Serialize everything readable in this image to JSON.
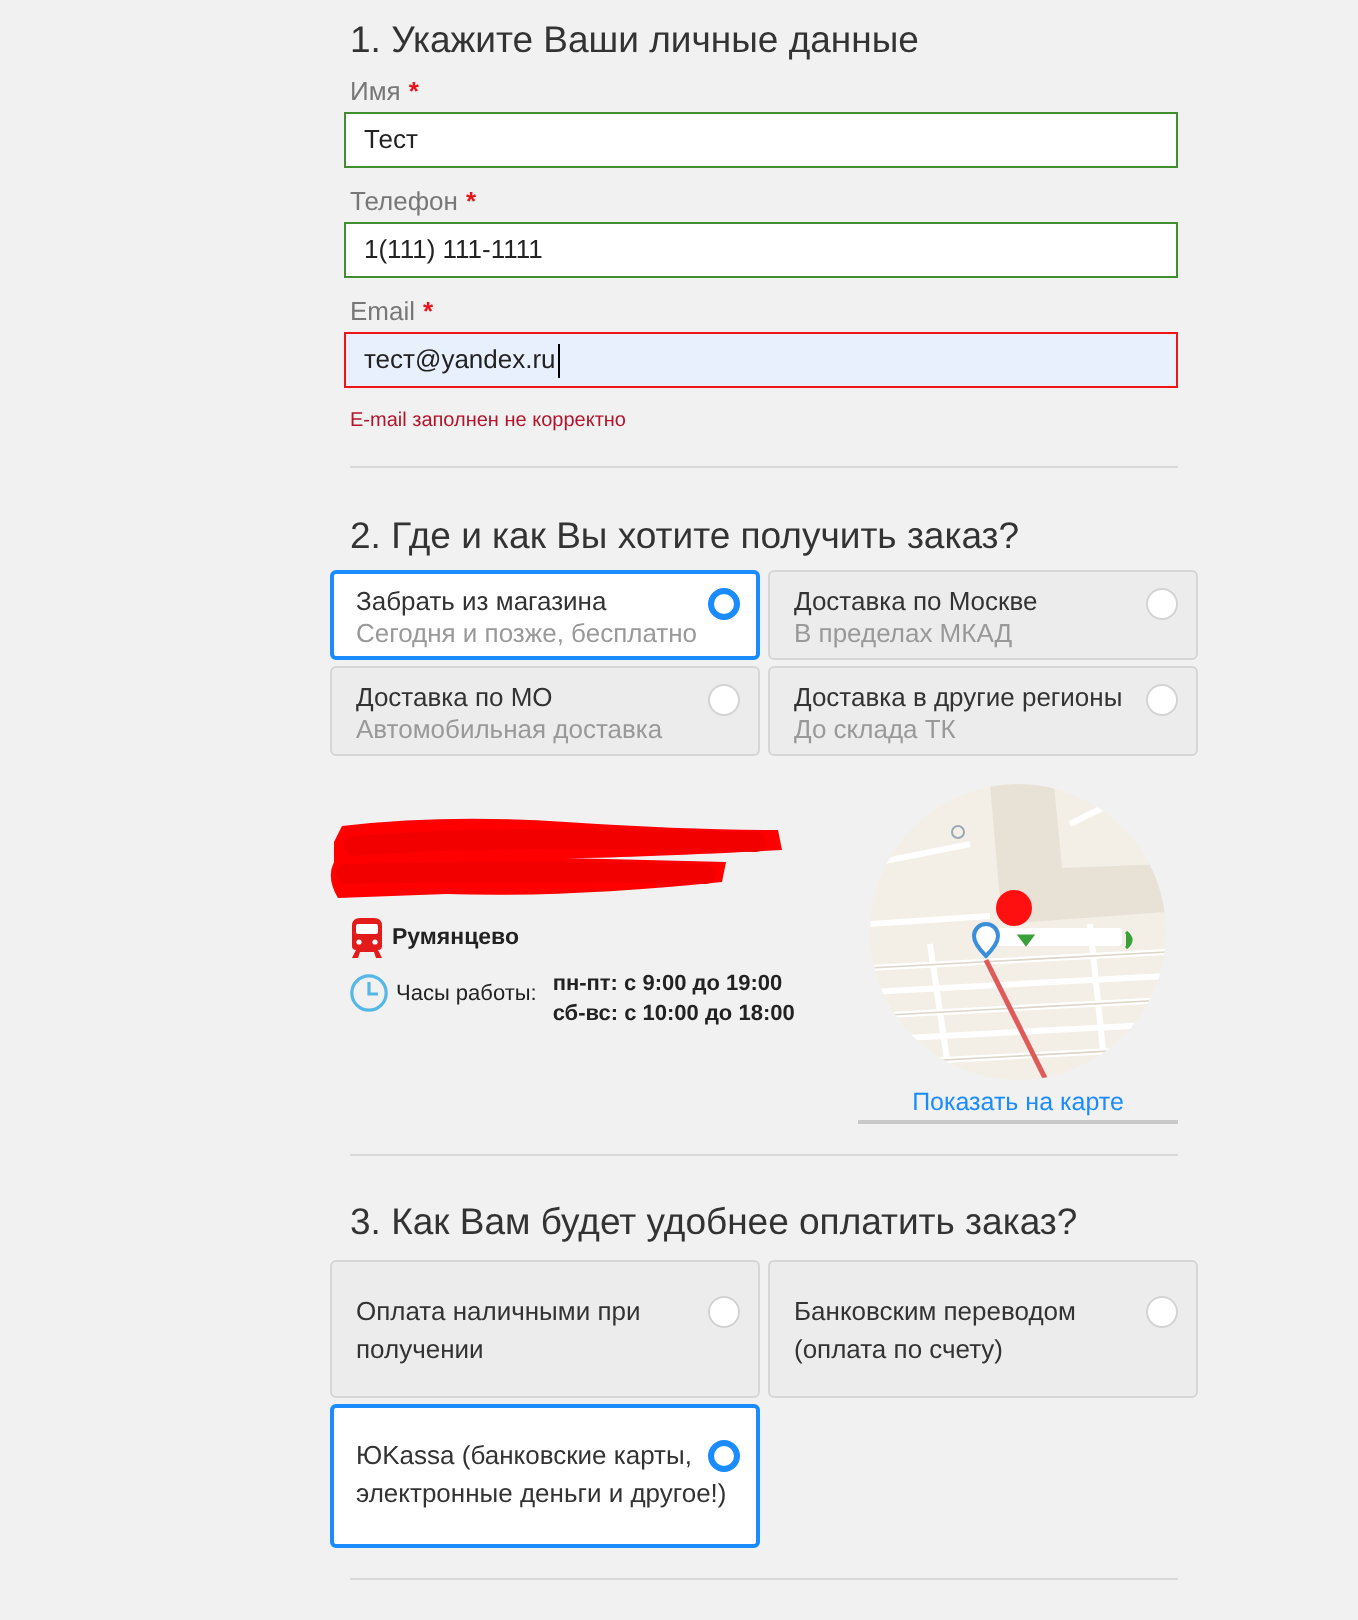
{
  "personal": {
    "title": "1. Укажите Ваши личные данные",
    "fields": [
      {
        "label": "Имя",
        "required_mark": "*",
        "value": "Тест",
        "valid": true,
        "focused": false,
        "autofilled": false
      },
      {
        "label": "Телефон",
        "required_mark": "*",
        "value": "1(111) 111-1111",
        "valid": true,
        "focused": false,
        "autofilled": false
      },
      {
        "label": "Email",
        "required_mark": "*",
        "value": "тест@yandex.ru",
        "valid": false,
        "focused": true,
        "autofilled": true,
        "error": "E-mail заполнен не корректно"
      }
    ]
  },
  "delivery": {
    "title": "2. Где и как Вы хотите получить заказ?",
    "options": [
      {
        "title": "Забрать из магазина",
        "subtitle": "Сегодня и позже, бесплатно",
        "selected": true
      },
      {
        "title": "Доставка по Москве",
        "subtitle": "В пределах МКАД",
        "selected": false
      },
      {
        "title": "Доставка по МО",
        "subtitle": "Автомобильная доставка",
        "selected": false
      },
      {
        "title": "Доставка в другие регионы",
        "subtitle": "До склада ТК",
        "selected": false
      }
    ]
  },
  "store": {
    "station": "Румянцево",
    "hours_label": "Часы работы:",
    "hours": [
      "пн-пт: с 9:00 до 19:00",
      "сб-вс: с 10:00 до 18:00"
    ],
    "map_link": "Показать на карте"
  },
  "payment": {
    "title": "3. Как Вам будет удобнее оплатить заказ?",
    "options": [
      {
        "label": "Оплата наличными при получении",
        "selected": false
      },
      {
        "label": "Банковским переводом (оплата по счету)",
        "selected": false
      },
      {
        "label": "ЮKassa (банковские карты, электронные деньги и другое!)",
        "selected": true
      }
    ]
  }
}
